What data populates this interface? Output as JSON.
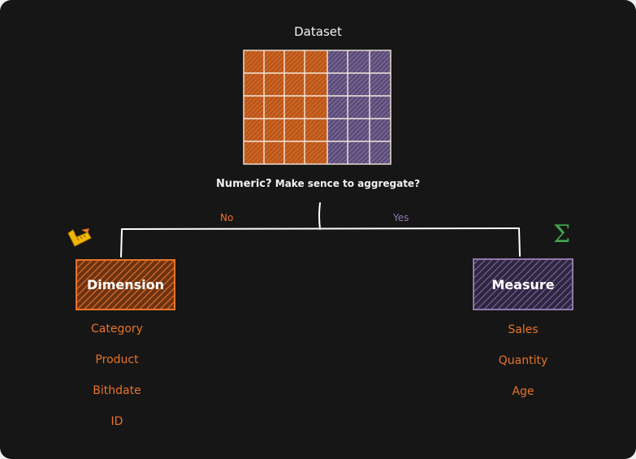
{
  "diagram": {
    "title": "Dataset",
    "question_main": "Numeric?",
    "question_sub": "Make sence to aggregate?",
    "branch_no": "No",
    "branch_yes": "Yes"
  },
  "dimension": {
    "label": "Dimension",
    "icon": "ruler-icon",
    "items": [
      "Category",
      "Product",
      "Bithdate",
      "ID"
    ]
  },
  "measure": {
    "label": "Measure",
    "icon": "sigma-icon",
    "icon_glyph": "Σ",
    "items": [
      "Sales",
      "Quantity",
      "Age"
    ]
  },
  "colors": {
    "background": "#161616",
    "dimension": "#e8732a",
    "measure": "#8f79ad",
    "line": "#ffffff",
    "sigma": "#3fa34d"
  }
}
